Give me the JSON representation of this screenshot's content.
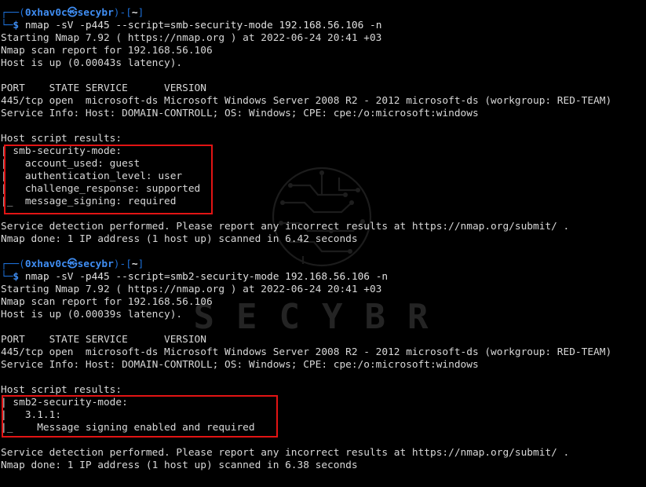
{
  "prompt1": {
    "user": "0xhav0c",
    "skull": "㉿",
    "host": "secybr",
    "dir": "~",
    "command": "nmap -sV -p445 --script=smb-security-mode 192.168.56.106 -n"
  },
  "scan1": {
    "start": "Starting Nmap 7.92 ( https://nmap.org ) at 2022-06-24 20:41 +03",
    "report": "Nmap scan report for 192.168.56.106",
    "hostup": "Host is up (0.00043s latency).",
    "header": "PORT    STATE SERVICE      VERSION",
    "port": "445/tcp open  microsoft-ds Microsoft Windows Server 2008 R2 - 2012 microsoft-ds (workgroup: RED-TEAM)",
    "service_info": "Service Info: Host: DOMAIN-CONTROLL; OS: Windows; CPE: cpe:/o:microsoft:windows",
    "script_results": "Host script results:",
    "result_lines": [
      "| smb-security-mode:",
      "|   account_used: guest",
      "|   authentication_level: user",
      "|   challenge_response: supported",
      "|_  message_signing: required"
    ],
    "detection": "Service detection performed. Please report any incorrect results at https://nmap.org/submit/ .",
    "done": "Nmap done: 1 IP address (1 host up) scanned in 6.42 seconds"
  },
  "prompt2": {
    "user": "0xhav0c",
    "skull": "㉿",
    "host": "secybr",
    "dir": "~",
    "command": "nmap -sV -p445 --script=smb2-security-mode 192.168.56.106 -n"
  },
  "scan2": {
    "start": "Starting Nmap 7.92 ( https://nmap.org ) at 2022-06-24 20:41 +03",
    "report": "Nmap scan report for 192.168.56.106",
    "hostup": "Host is up (0.00039s latency).",
    "header": "PORT    STATE SERVICE      VERSION",
    "port": "445/tcp open  microsoft-ds Microsoft Windows Server 2008 R2 - 2012 microsoft-ds (workgroup: RED-TEAM)",
    "service_info": "Service Info: Host: DOMAIN-CONTROLL; OS: Windows; CPE: cpe:/o:microsoft:windows",
    "script_results": "Host script results:",
    "result_lines": [
      "| smb2-security-mode:",
      "|   3.1.1:",
      "|_    Message signing enabled and required"
    ],
    "detection": "Service detection performed. Please report any incorrect results at https://nmap.org/submit/ .",
    "done": "Nmap done: 1 IP address (1 host up) scanned in 6.38 seconds"
  },
  "watermark": {
    "text": "SECYBR",
    "icon": "circuit-brain-icon"
  },
  "colors": {
    "background": "#000000",
    "text": "#d8d8d8",
    "prompt_blue": "#3f8df2",
    "highlight_red": "#e21414"
  }
}
